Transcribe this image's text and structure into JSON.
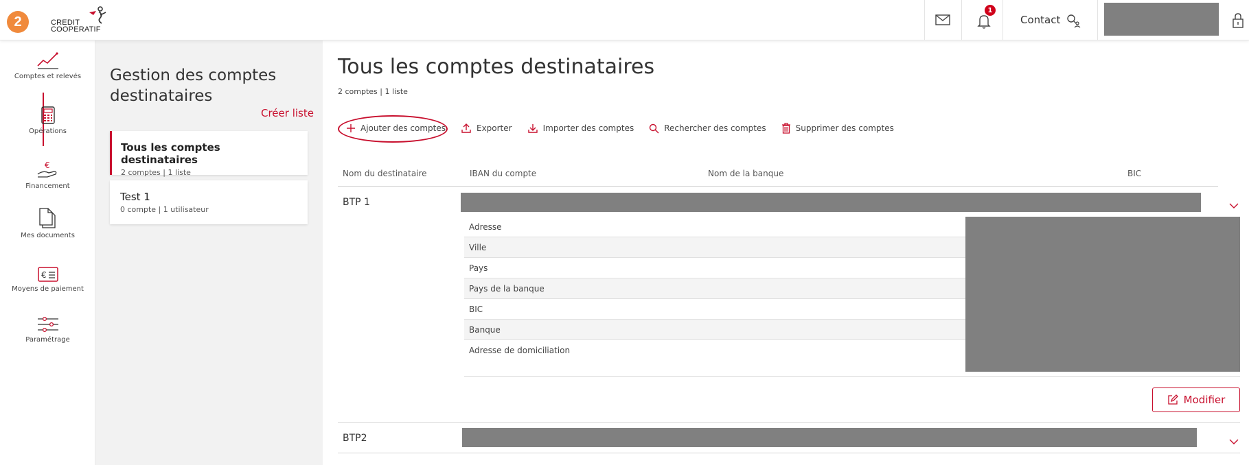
{
  "step_badge": "2",
  "brand": {
    "line1": "CREDIT",
    "line2": "COOPERATIF",
    "accent": "#c8102e"
  },
  "header": {
    "contact_label": "Contact",
    "notifications_count": "1"
  },
  "rail": {
    "items": [
      {
        "label": "Comptes et relevés",
        "icon": "chart-line-icon"
      },
      {
        "label": "Opérations",
        "icon": "calculator-icon"
      },
      {
        "label": "Financement",
        "icon": "euro-hand-icon"
      },
      {
        "label": "Mes documents",
        "icon": "documents-icon"
      },
      {
        "label": "Moyens de paiement",
        "icon": "card-euro-icon"
      },
      {
        "label": "Paramétrage",
        "icon": "sliders-icon"
      }
    ]
  },
  "panel": {
    "title": "Gestion des comptes destinataires",
    "create_label": "Créer liste",
    "lists": [
      {
        "title": "Tous les comptes destinataires",
        "subtitle": "2 comptes | 1 liste"
      },
      {
        "title": "Test 1",
        "subtitle": "0 compte  | 1 utilisateur"
      }
    ]
  },
  "main": {
    "title": "Tous les comptes destinataires",
    "subtitle": "2 comptes | 1 liste",
    "toolbar": {
      "add": "Ajouter des comptes",
      "export": "Exporter",
      "import": "Importer des comptes",
      "search": "Rechercher des comptes",
      "delete": "Supprimer des comptes"
    },
    "columns": [
      "Nom du destinataire",
      "IBAN du compte",
      "Nom de la banque",
      "BIC"
    ],
    "rows": [
      {
        "name": "BTP 1"
      },
      {
        "name": "BTP2"
      }
    ],
    "detail_fields": [
      "Adresse",
      "Ville",
      "Pays",
      "Pays de la banque",
      "BIC",
      "Banque",
      "Adresse de domiciliation"
    ],
    "modify_label": "Modifier"
  }
}
